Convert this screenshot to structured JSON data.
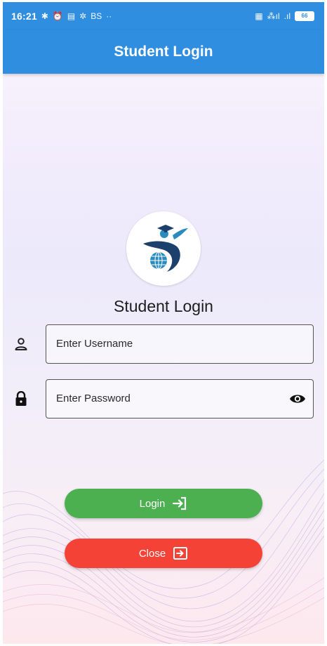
{
  "status_bar": {
    "time": "16:21",
    "left_glyphs": [
      "✱",
      "⏰",
      "▤",
      "✲",
      "BS",
      "··"
    ],
    "right_glyphs": [
      "▦",
      "⁂ıl",
      ".ıl"
    ],
    "battery": "66"
  },
  "app_bar": {
    "title": "Student Login"
  },
  "heading": "Student Login",
  "username": {
    "placeholder": "Enter Username",
    "value": ""
  },
  "password": {
    "placeholder": "Enter Password",
    "value": ""
  },
  "buttons": {
    "login_label": "Login",
    "close_label": "Close"
  },
  "colors": {
    "primary": "#2f8ee0",
    "login": "#4caf50",
    "close": "#f44336",
    "logo_navy": "#1c3f6b",
    "logo_teal": "#2b8bbd"
  },
  "icons": {
    "username": "person-icon",
    "password": "lock-icon",
    "visibility": "eye-icon",
    "login": "login-arrow-icon",
    "close": "exit-icon"
  }
}
